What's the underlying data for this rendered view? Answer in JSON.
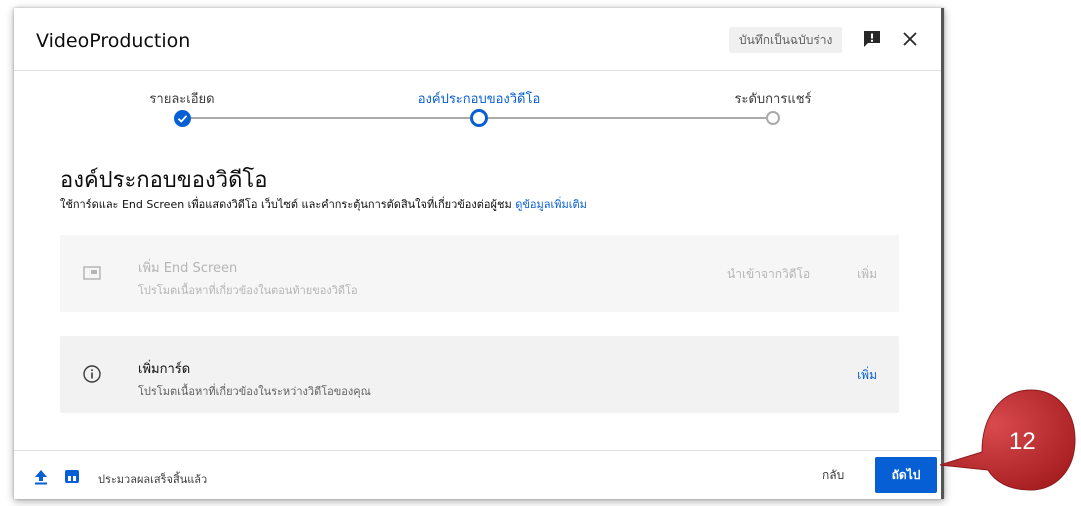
{
  "dialog": {
    "title": "VideoProduction",
    "draft_label": "บันทึกเป็นฉบับร่าง"
  },
  "stepper": {
    "steps": [
      {
        "label": "รายละเอียด",
        "state": "done"
      },
      {
        "label": "องค์ประกอบของวิดีโอ",
        "state": "active"
      },
      {
        "label": "ระดับการแชร์",
        "state": "upcoming"
      }
    ]
  },
  "section": {
    "title": "องค์ประกอบของวิดีโอ",
    "description": "ใช้การ์ดและ End Screen เพื่อแสดงวิดีโอ เว็บไซต์ และคำกระตุ้นการตัดสินใจที่เกี่ยวข้องต่อผู้ชม",
    "learn_more": "ดูข้อมูลเพิ่มเติม"
  },
  "cards": [
    {
      "title": "เพิ่ม End Screen",
      "subtitle": "โปรโมตเนื้อหาที่เกี่ยวข้องในตอนท้ายของวิดีโอ",
      "import_label": "นำเข้าจากวิดีโอ",
      "add_label": "เพิ่ม",
      "enabled": false
    },
    {
      "title": "เพิ่มการ์ด",
      "subtitle": "โปรโมตเนื้อหาที่เกี่ยวข้องในระหว่างวิดีโอของคุณ",
      "add_label": "เพิ่ม",
      "enabled": true
    }
  ],
  "footer": {
    "status": "ประมวลผลเสร็จสิ้นแล้ว",
    "back_label": "กลับ",
    "next_label": "ถัดไป"
  },
  "callout": {
    "number": "12",
    "color": "#c0282b"
  },
  "colors": {
    "accent": "#065fd4",
    "disabled_text": "#b5b5b5"
  },
  "icons": [
    "feedback-icon",
    "close-icon",
    "check-icon",
    "end-screen-icon",
    "info-icon",
    "upload-icon",
    "hd-icon"
  ]
}
